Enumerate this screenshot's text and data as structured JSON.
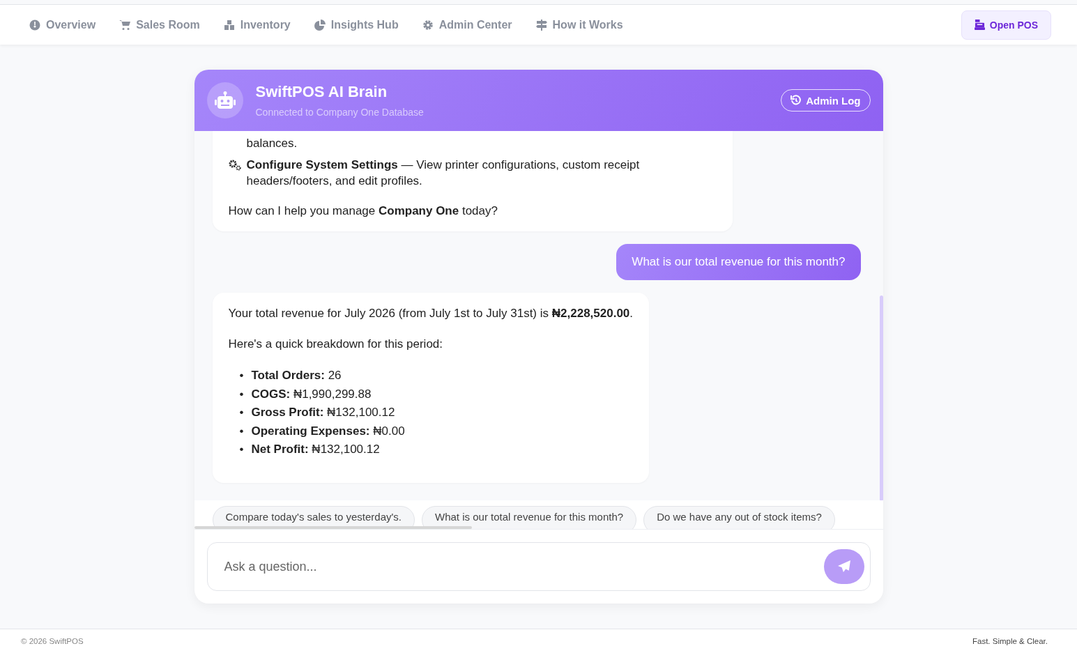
{
  "nav": {
    "items": [
      {
        "label": "Overview",
        "selected": false
      },
      {
        "label": "Sales Room",
        "selected": false
      },
      {
        "label": "Inventory",
        "selected": false
      },
      {
        "label": "Insights Hub",
        "selected": false
      },
      {
        "label": "Admin Center",
        "selected": false
      },
      {
        "label": "How it Works",
        "selected": false
      }
    ],
    "action": {
      "label": "Open POS"
    }
  },
  "chat": {
    "title": "SwiftPOS AI Brain",
    "subtitle": "Connected to Company One Database",
    "header_button": "Admin Log",
    "messages": [
      {
        "kind": "bot",
        "blocks": [
          {
            "kind": "continuation",
            "text": "balances."
          },
          {
            "kind": "feature",
            "text": "**Configure System Settings** — View printer configurations, custom receipt headers/footers, and edit profiles."
          },
          {
            "kind": "paragraph",
            "text": "How can I help you manage **Company One** today?"
          }
        ]
      },
      {
        "kind": "user",
        "blocks": [
          {
            "kind": "paragraph",
            "text": "What is our total revenue for this month?"
          }
        ]
      },
      {
        "kind": "bot",
        "blocks": [
          {
            "kind": "paragraph",
            "text": "Your total revenue for July 2026 (from July 1st to July 31st) is **₦2,228,520.00**."
          },
          {
            "kind": "paragraph",
            "text": "Here's a quick breakdown for this period:"
          },
          {
            "kind": "bullets",
            "items": [
              {
                "marker": "•",
                "text": "**Total Orders:** 26"
              },
              {
                "marker": "•",
                "text": "**COGS:** ₦1,990,299.88"
              },
              {
                "marker": "•",
                "text": "**Gross Profit:** ₦132,100.12"
              },
              {
                "marker": "•",
                "text": "**Operating Expenses:** ₦0.00"
              },
              {
                "marker": "•",
                "text": "**Net Profit:** ₦132,100.12"
              }
            ]
          }
        ]
      }
    ],
    "suggestions": [
      "Compare today's sales to yesterday's.",
      "What is our total revenue for this month?",
      "Do we have any out of stock items?"
    ],
    "input": {
      "placeholder": "Ask a question..."
    }
  },
  "footer": {
    "copyright": "© 2026 SwiftPOS",
    "tagline": "Fast. Simple & Clear."
  }
}
